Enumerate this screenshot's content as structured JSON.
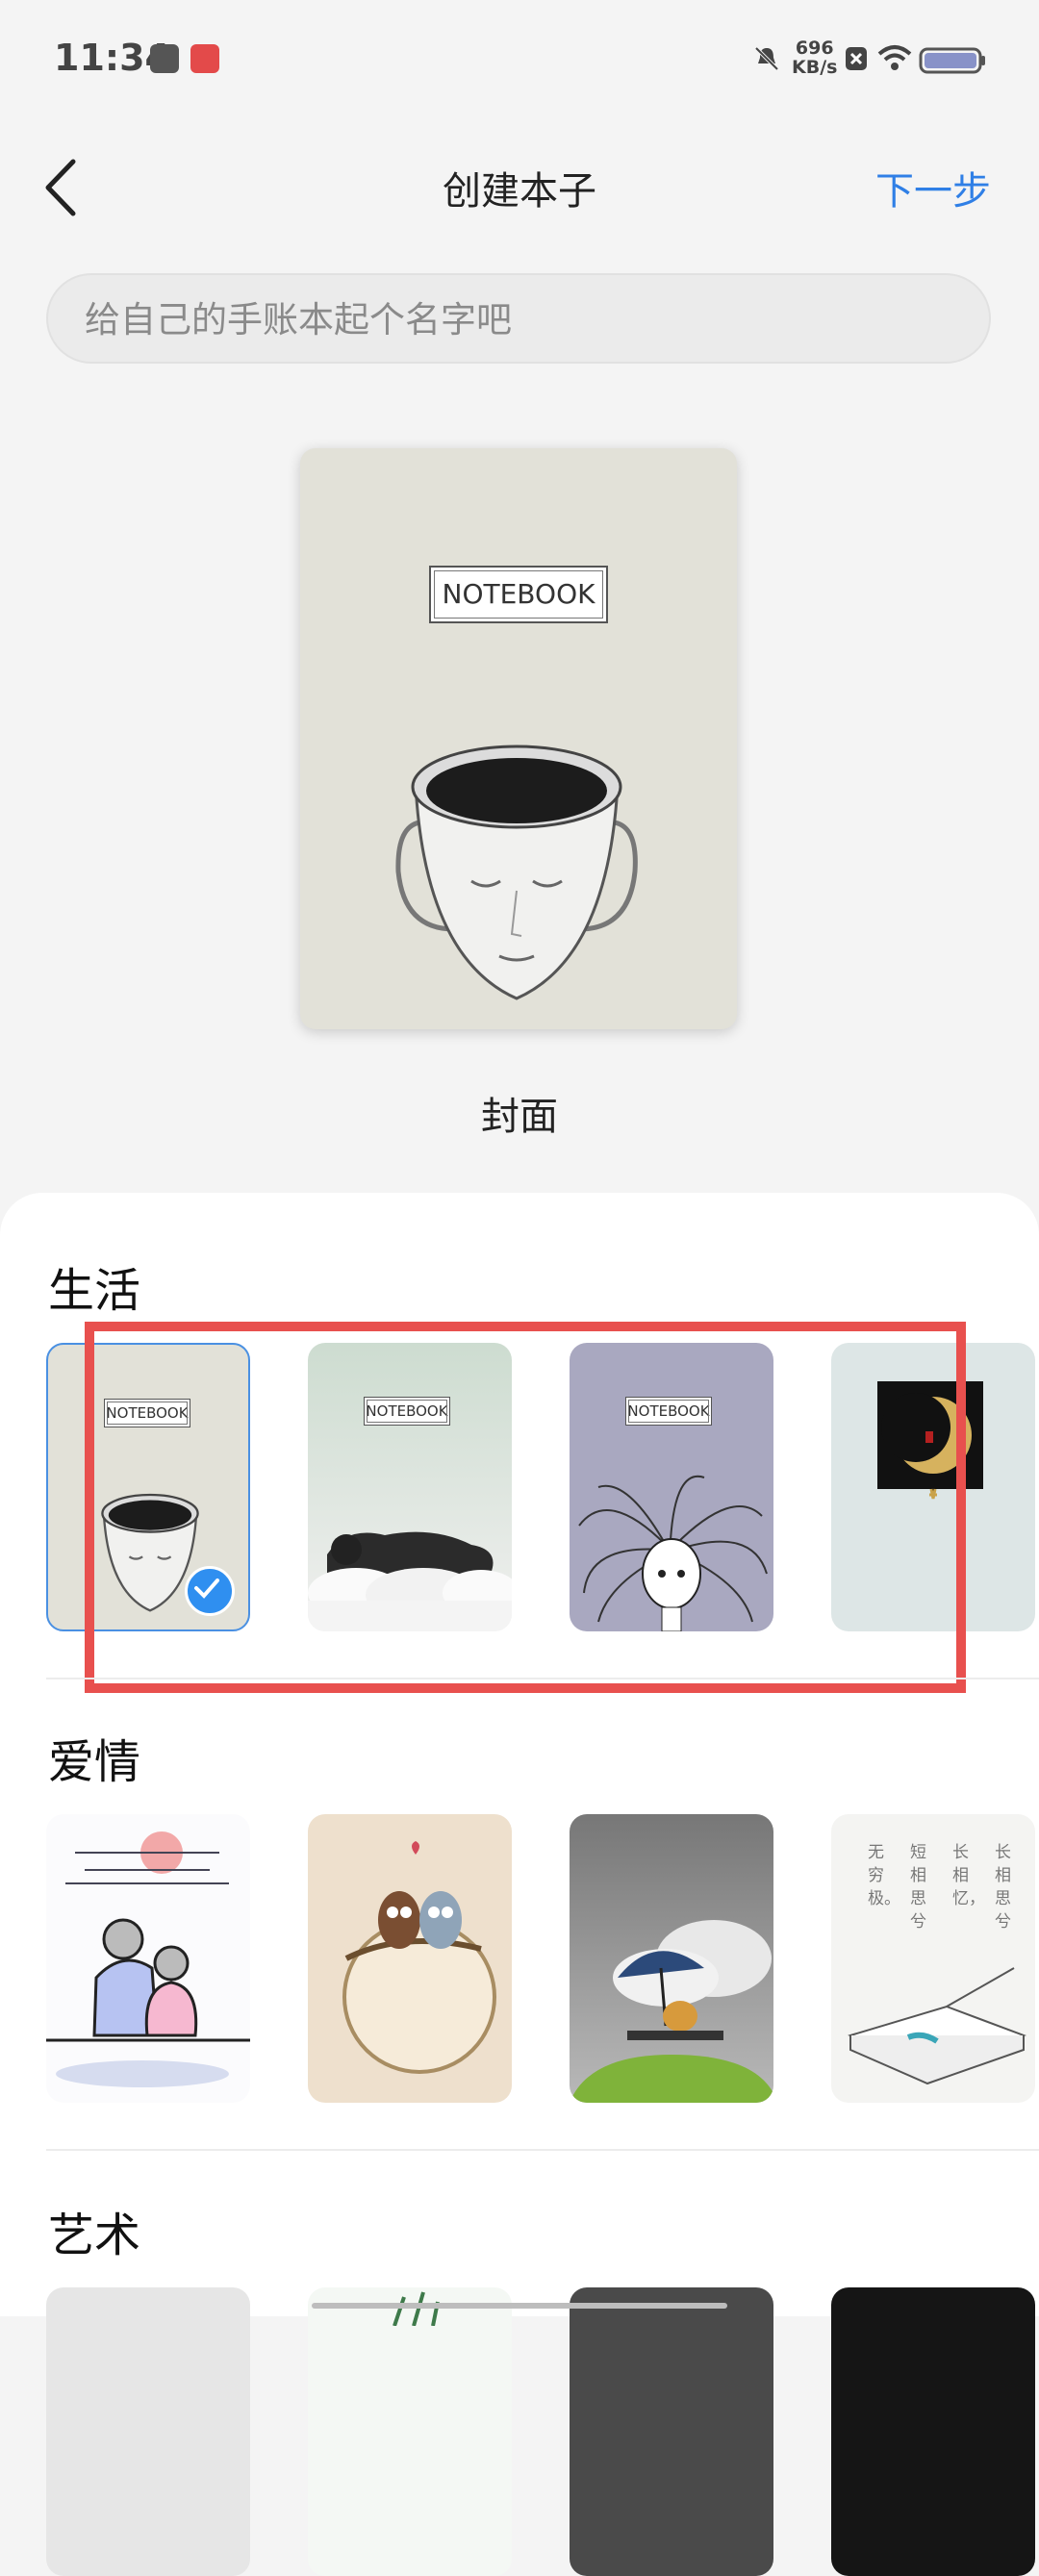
{
  "status_bar": {
    "time": "11:34",
    "net_speed_value": "696",
    "net_speed_unit": "KB/s",
    "icons": [
      "calendar-app-icon",
      "huawei-app-icon",
      "mute-bell-icon",
      "sim-x-icon",
      "wifi-icon",
      "battery-icon"
    ]
  },
  "header": {
    "title": "创建本子",
    "next_label": "下一步"
  },
  "name_input": {
    "placeholder": "给自己的手账本起个名字吧",
    "value": ""
  },
  "preview": {
    "cover_label": "NOTEBOOK",
    "caption": "封面"
  },
  "categories": [
    {
      "title": "生活",
      "items": [
        {
          "label": "NOTEBOOK",
          "selected": true
        },
        {
          "label": "NOTEBOOK",
          "selected": false
        },
        {
          "label": "NOTEBOOK",
          "selected": false
        },
        {
          "label": "",
          "selected": false
        }
      ]
    },
    {
      "title": "爱情",
      "poem_lines": [
        "长相思兮",
        "长相忆，",
        "短相思兮",
        "无穷极。"
      ]
    },
    {
      "title": "艺术"
    }
  ],
  "colors": {
    "accent": "#2f7fe6",
    "highlight_box": "#e8504e",
    "sheet_bg": "#ffffff",
    "page_bg": "#f4f4f4"
  }
}
